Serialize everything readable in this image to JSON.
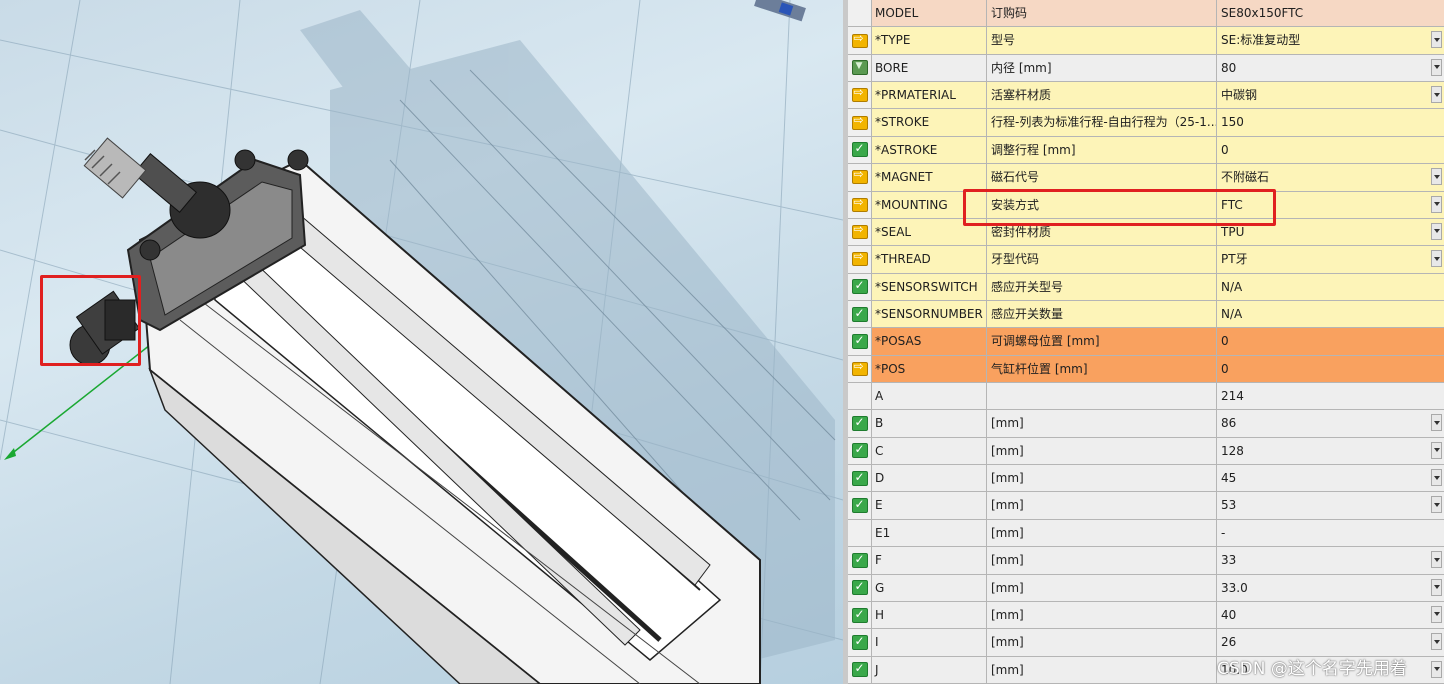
{
  "watermark": "CSDN @这个名字先用着",
  "rows": [
    {
      "icon": "none",
      "name": "MODEL",
      "desc": "订购码",
      "value": "SE80x150FTC",
      "bg": "salmon",
      "dropdown": false
    },
    {
      "icon": "arrow",
      "name": "*TYPE",
      "desc": "型号",
      "value": "SE:标准复动型",
      "bg": "yellow",
      "dropdown": true
    },
    {
      "icon": "filter",
      "name": "BORE",
      "desc": "内径 [mm]",
      "value": "80",
      "bg": "gray",
      "dropdown": true
    },
    {
      "icon": "arrow",
      "name": "*PRMATERIAL",
      "desc": "活塞杆材质",
      "value": "中碳钢",
      "bg": "yellow",
      "dropdown": true
    },
    {
      "icon": "arrow",
      "name": "*STROKE",
      "desc": "行程-列表为标准行程-自由行程为（25-1...",
      "value": "150",
      "bg": "yellow",
      "dropdown": false
    },
    {
      "icon": "check",
      "name": "*ASTROKE",
      "desc": "调整行程 [mm]",
      "value": "0",
      "bg": "yellow",
      "dropdown": false
    },
    {
      "icon": "arrow",
      "name": "*MAGNET",
      "desc": "磁石代号",
      "value": "不附磁石",
      "bg": "yellow",
      "dropdown": true
    },
    {
      "icon": "arrow",
      "name": "*MOUNTING",
      "desc": "安装方式",
      "value": "FTC",
      "bg": "yellow",
      "dropdown": true
    },
    {
      "icon": "arrow",
      "name": "*SEAL",
      "desc": "密封件材质",
      "value": "TPU",
      "bg": "yellow",
      "dropdown": true
    },
    {
      "icon": "arrow",
      "name": "*THREAD",
      "desc": "牙型代码",
      "value": "PT牙",
      "bg": "yellow",
      "dropdown": true
    },
    {
      "icon": "check",
      "name": "*SENSORSWITCH",
      "desc": "感应开关型号",
      "value": "N/A",
      "bg": "yellow",
      "dropdown": false
    },
    {
      "icon": "check",
      "name": "*SENSORNUMBER",
      "desc": "感应开关数量",
      "value": "N/A",
      "bg": "yellow",
      "dropdown": false
    },
    {
      "icon": "check",
      "name": "*POSAS",
      "desc": "可调螺母位置 [mm]",
      "value": "0",
      "bg": "orange",
      "dropdown": false
    },
    {
      "icon": "arrow",
      "name": "*POS",
      "desc": "气缸杆位置 [mm]",
      "value": "0",
      "bg": "orange",
      "dropdown": false
    },
    {
      "icon": "none",
      "name": "A",
      "desc": "",
      "value": "214",
      "bg": "gray",
      "dropdown": false
    },
    {
      "icon": "check",
      "name": "B",
      "desc": "[mm]",
      "value": "86",
      "bg": "gray",
      "dropdown": true
    },
    {
      "icon": "check",
      "name": "C",
      "desc": "[mm]",
      "value": "128",
      "bg": "gray",
      "dropdown": true
    },
    {
      "icon": "check",
      "name": "D",
      "desc": "[mm]",
      "value": "45",
      "bg": "gray",
      "dropdown": true
    },
    {
      "icon": "check",
      "name": "E",
      "desc": "[mm]",
      "value": "53",
      "bg": "gray",
      "dropdown": true
    },
    {
      "icon": "none",
      "name": "E1",
      "desc": "[mm]",
      "value": "-",
      "bg": "gray",
      "dropdown": false
    },
    {
      "icon": "check",
      "name": "F",
      "desc": "[mm]",
      "value": "33",
      "bg": "gray",
      "dropdown": true
    },
    {
      "icon": "check",
      "name": "G",
      "desc": "[mm]",
      "value": "33.0",
      "bg": "gray",
      "dropdown": true
    },
    {
      "icon": "check",
      "name": "H",
      "desc": "[mm]",
      "value": "40",
      "bg": "gray",
      "dropdown": true
    },
    {
      "icon": "check",
      "name": "I",
      "desc": "[mm]",
      "value": "26",
      "bg": "gray",
      "dropdown": true
    },
    {
      "icon": "check",
      "name": "J",
      "desc": "[mm]",
      "value": "10.0",
      "bg": "gray",
      "dropdown": true
    }
  ]
}
